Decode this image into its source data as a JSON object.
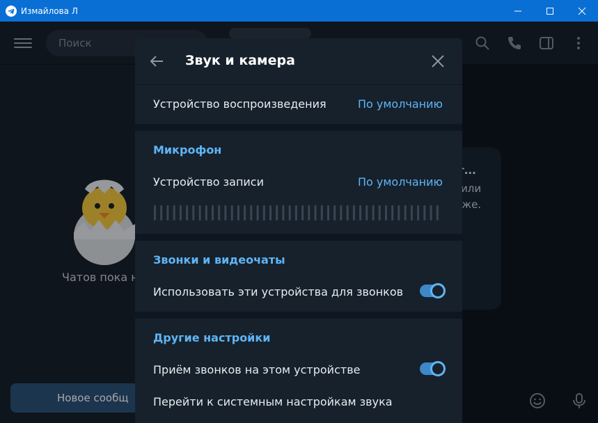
{
  "window": {
    "title": "Измайлова Л"
  },
  "background": {
    "search_placeholder": "Поиск",
    "empty_chats": "Чатов пока н",
    "info_title": "т...",
    "info_line1": "или",
    "info_line2": "ниже.",
    "new_message_button": "Новое сообщ"
  },
  "dialog": {
    "title": "Звук и камера",
    "playback": {
      "label": "Устройство воспроизведения",
      "value": "По умолчанию"
    },
    "microphone": {
      "section_title": "Микрофон",
      "label": "Устройство записи",
      "value": "По умолчанию",
      "level": 0
    },
    "calls": {
      "section_title": "Звонки и видеочаты",
      "use_devices_label": "Использовать эти устройства для звонков",
      "use_devices_enabled": true
    },
    "other": {
      "section_title": "Другие настройки",
      "accept_calls_label": "Приём звонков на этом устройстве",
      "accept_calls_enabled": true,
      "system_settings_label": "Перейти к системным настройкам звука"
    }
  },
  "colors": {
    "accent": "#5eb5f7",
    "titlebar": "#0a6fd4",
    "dialog_bg": "#17212b"
  }
}
